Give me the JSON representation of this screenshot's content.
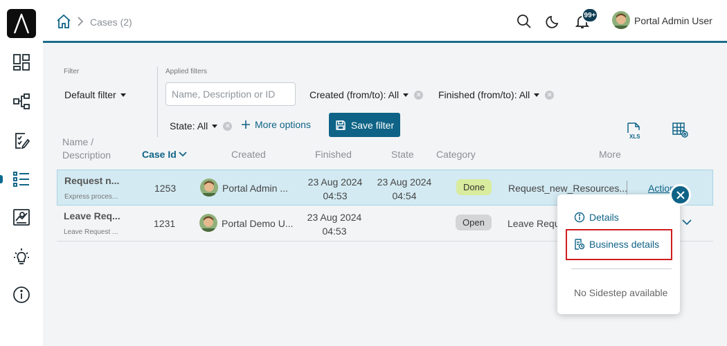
{
  "colors": {
    "brand": "#0e6386",
    "highlight": "#d01c1c",
    "done_badge": "#d9eb9d",
    "open_badge": "#d3d5d7",
    "selected_row": "#d3eaf2"
  },
  "sidebar": {
    "logo_icon": "app-logo-icon",
    "items": [
      {
        "icon": "dashboard-icon"
      },
      {
        "icon": "process-icon"
      },
      {
        "icon": "tasks-icon"
      },
      {
        "icon": "cases-icon",
        "active": true
      },
      {
        "icon": "statistics-icon"
      },
      {
        "icon": "ideas-icon"
      },
      {
        "icon": "info-icon"
      }
    ]
  },
  "header": {
    "breadcrumb": {
      "current": "Cases (2)"
    },
    "notifications_badge": "99+",
    "user_name": "Portal Admin User"
  },
  "filters": {
    "filter_label": "Filter",
    "default_filter": "Default filter",
    "applied_label": "Applied filters",
    "search_placeholder": "Name, Description or ID",
    "created": "Created (from/to): All",
    "finished": "Finished (from/to): All",
    "state": "State: All",
    "more_options": "More options",
    "save_filter": "Save filter"
  },
  "table": {
    "columns": {
      "name_line1": "Name /",
      "name_line2": "Description",
      "case_id": "Case Id",
      "created": "Created",
      "finished": "Finished",
      "state": "State",
      "category": "Category",
      "more": "More"
    },
    "rows": [
      {
        "title": "Request n...",
        "description": "Express proces...",
        "case_id": "1253",
        "creator": "Portal Admin ...",
        "created_date": "23 Aug 2024",
        "created_time": "04:53",
        "finished_date": "23 Aug 2024",
        "finished_time": "04:54",
        "state": "Done",
        "category": "Request_new_Resources...",
        "actions": "Actions"
      },
      {
        "title": "Leave Req...",
        "description": "Leave Request ...",
        "case_id": "1231",
        "creator": "Portal Demo U...",
        "created_date": "23 Aug 2024",
        "created_time": "04:53",
        "finished_date": "",
        "finished_time": "",
        "state": "Open",
        "category": "Leave Reque"
      }
    ]
  },
  "actions_menu": {
    "details": "Details",
    "business_details": "Business details",
    "no_sidestep": "No Sidestep available"
  }
}
